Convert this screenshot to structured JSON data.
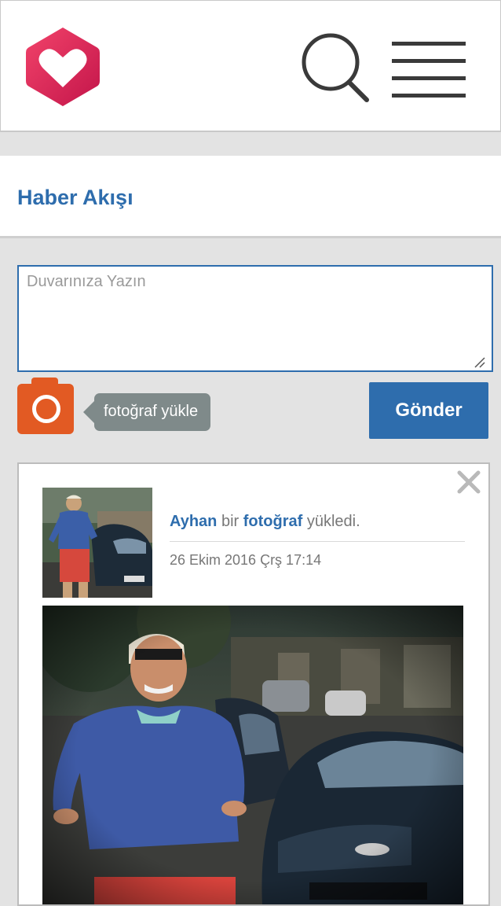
{
  "header": {
    "logo_icon": "heart-hexagon-logo",
    "search_icon": "search-icon",
    "menu_icon": "hamburger-menu-icon",
    "accent_color": "#e0245e"
  },
  "feed": {
    "title": "Haber Akışı"
  },
  "composer": {
    "placeholder": "Duvarınıza Yazın",
    "camera_icon": "camera-icon",
    "upload_label": "fotoğraf yükle",
    "send_label": "Gönder"
  },
  "post": {
    "author": "Ayhan",
    "connector": "bir",
    "object": "fotoğraf",
    "verb": "yükledi.",
    "timestamp": "26 Ekim 2016 Çrş 17:14",
    "close_icon": "close-icon"
  },
  "colors": {
    "primary": "#2e6dad",
    "camera": "#e25a23",
    "tooltip": "#7f8a8a",
    "background": "#e3e3e3"
  }
}
